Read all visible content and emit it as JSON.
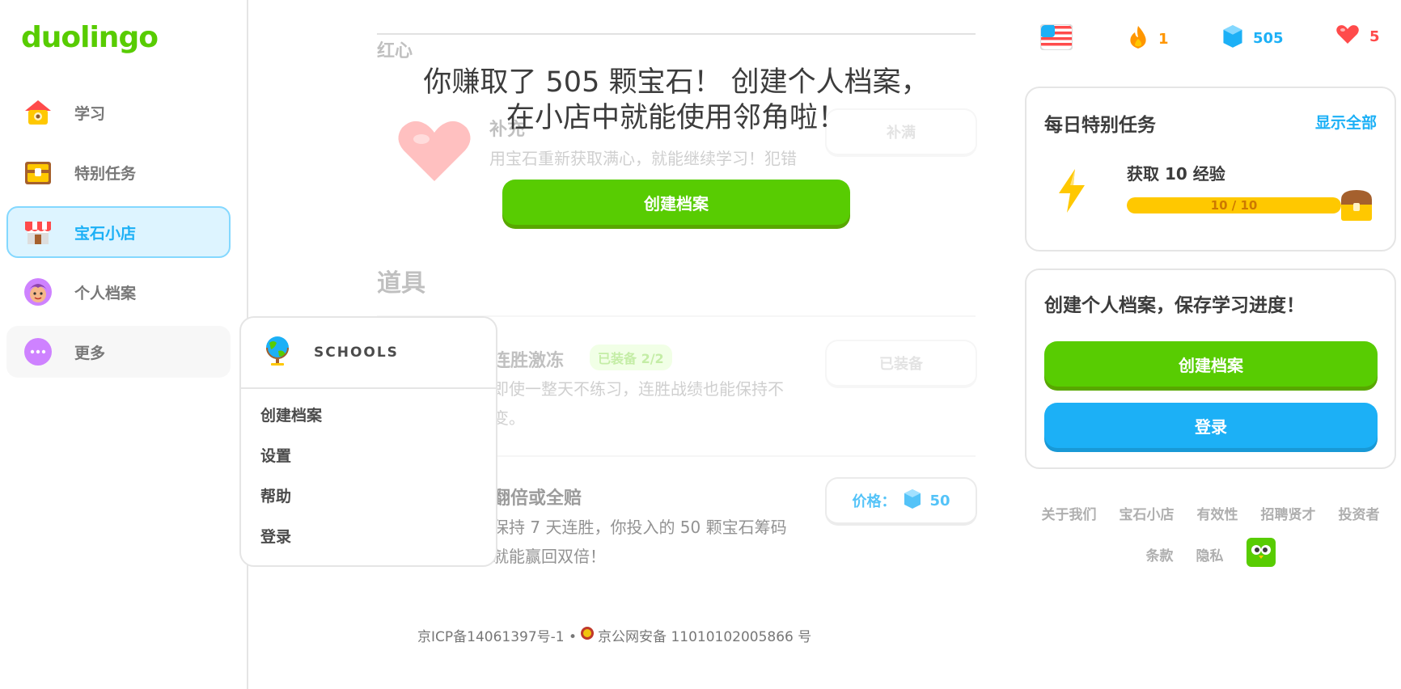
{
  "brand": {
    "logo": "duolingo",
    "accent": "#58cc02",
    "blue": "#1cb0f6"
  },
  "sidebar": {
    "items": [
      {
        "label": "学习",
        "icon": "home-icon",
        "active": false
      },
      {
        "label": "特别任务",
        "icon": "treasure-chest-icon",
        "active": false
      },
      {
        "label": "宝石小店",
        "icon": "shop-icon",
        "active": true
      },
      {
        "label": "个人档案",
        "icon": "avatar-icon",
        "active": false
      },
      {
        "label": "更多",
        "icon": "more-icon",
        "active": false
      }
    ]
  },
  "dropdown": {
    "header": "SCHOOLS",
    "header_icon": "globe-icon",
    "items": [
      "创建档案",
      "设置",
      "帮助",
      "登录"
    ]
  },
  "main": {
    "section_top_title": "红心",
    "heart_item": {
      "name": "补充",
      "desc": "用宝石重新获取满心，就能继续学习！犯错",
      "button": "补满"
    },
    "promo": {
      "line1": "你赚取了 505 颗宝石！ 创建个人档案，",
      "line2": "在小店中就能使用邻角啦！",
      "button": "创建档案"
    },
    "section_items_title": "道具",
    "streak_freeze": {
      "name": "连胜激冻",
      "badge": "已装备 2/2",
      "desc_line1": "即使一整天不练习，连胜战绩也能保持不",
      "desc_line2": "变。",
      "button": "已装备"
    },
    "double_or_nothing": {
      "name": "翻倍或全赔",
      "desc_line1": "保持 7 天连胜，你投入的 50 颗宝石筹码",
      "desc_line2": "就能赢回双倍！",
      "price_label": "价格：",
      "price": "50"
    },
    "footer_icp": "京ICP备14061397号-1 •",
    "footer_police": "京公网安备 11010102005866 号"
  },
  "topbar": {
    "course_flag": "us-flag-icon",
    "streak": "1",
    "gems": "505",
    "hearts": "5"
  },
  "quests_card": {
    "title": "每日特别任务",
    "link": "显示全部",
    "quest_label": "获取 10 经验",
    "progress_text": "10 / 10",
    "progress_fraction": 1.0
  },
  "profile_card": {
    "title": "创建个人档案，保存学习进度！",
    "create_button": "创建档案",
    "login_button": "登录"
  },
  "footer_links": {
    "row1": [
      "关于我们",
      "宝石小店",
      "有效性",
      "招聘贤才",
      "投资者"
    ],
    "row2": [
      "条款",
      "隐私"
    ]
  }
}
